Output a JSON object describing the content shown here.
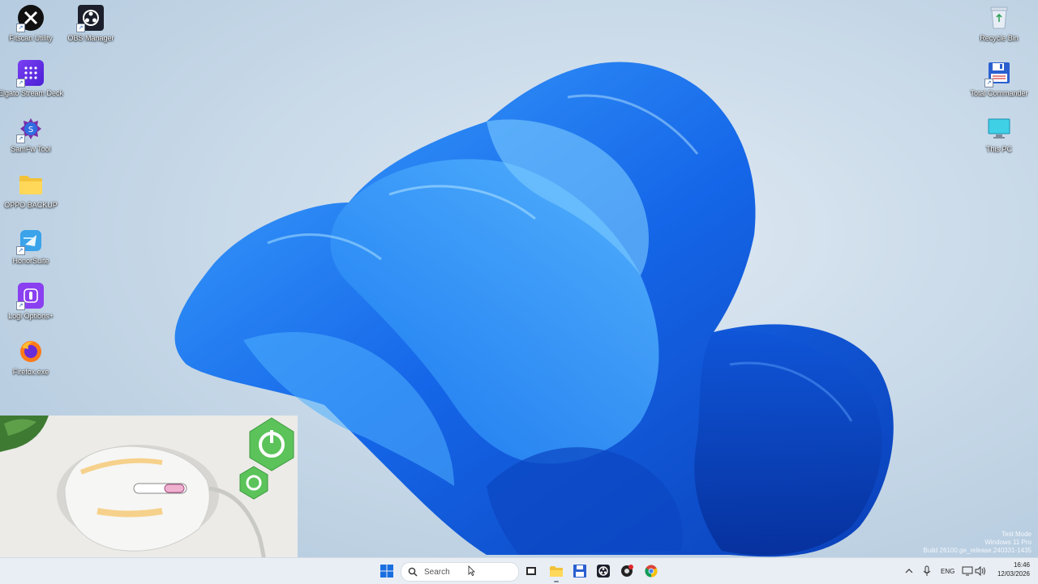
{
  "desktop": {
    "left_icons": [
      {
        "label": "Fitscan Utility",
        "icon": "fitscan-icon"
      },
      {
        "label": "OBS Manager",
        "icon": "obs-icon"
      },
      {
        "label": "Elgato Stream Deck",
        "icon": "stream-deck-icon"
      },
      {
        "label": "SamFw Tool",
        "icon": "samfw-icon"
      },
      {
        "label": "OPPO BACKUP",
        "icon": "folder-icon"
      },
      {
        "label": "HonorSuite",
        "icon": "honorsuite-icon"
      },
      {
        "label": "Logi Options+",
        "icon": "logi-icon"
      },
      {
        "label": "Firefox.exe",
        "icon": "firefox-icon"
      }
    ],
    "right_icons": [
      {
        "label": "Recycle Bin",
        "icon": "recycle-bin-icon"
      },
      {
        "label": "Total Commander",
        "icon": "total-commander-icon"
      },
      {
        "label": "This PC",
        "icon": "this-pc-icon"
      }
    ]
  },
  "watermark": {
    "line1": "Test Mode",
    "line2": "Windows 11 Pro",
    "line3": "Build 26100.ge_release.240331-1435"
  },
  "taskbar": {
    "search": {
      "placeholder": "Search"
    },
    "apps": [
      "start-icon",
      "task-view-icon",
      "file-explorer-icon",
      "total-commander-icon",
      "obs-icon",
      "app-icon",
      "chrome-icon"
    ],
    "tray": {
      "language": "ENG",
      "time": "16:46",
      "date": "12/03/2026"
    }
  },
  "colors": {
    "accent": "#0a5ad6",
    "taskbar_bg": "#e9eef4"
  }
}
